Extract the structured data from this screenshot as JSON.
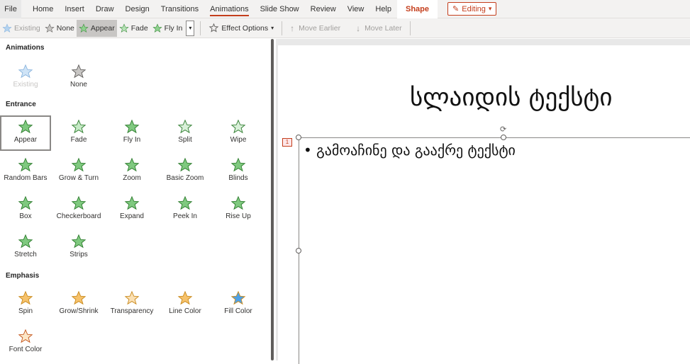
{
  "menu": {
    "tabs": [
      "File",
      "Home",
      "Insert",
      "Draw",
      "Design",
      "Transitions",
      "Animations",
      "Slide Show",
      "Review",
      "View",
      "Help",
      "Shape"
    ],
    "active": "Animations",
    "editing_label": "Editing"
  },
  "ribbon": {
    "existing": "Existing",
    "none": "None",
    "appear": "Appear",
    "fade": "Fade",
    "fly_in": "Fly In",
    "effect_options": "Effect Options",
    "move_earlier": "Move Earlier",
    "move_later": "Move Later"
  },
  "pane": {
    "sections": {
      "animations": "Animations",
      "entrance": "Entrance",
      "emphasis": "Emphasis"
    },
    "animations": [
      "Existing",
      "None"
    ],
    "entrance": [
      "Appear",
      "Fade",
      "Fly In",
      "Split",
      "Wipe",
      "Random Bars",
      "Grow & Turn",
      "Zoom",
      "Basic Zoom",
      "Blinds",
      "Box",
      "Checkerboard",
      "Expand",
      "Peek In",
      "Rise Up",
      "Stretch",
      "Strips"
    ],
    "emphasis": [
      "Spin",
      "Grow/Shrink",
      "Transparency",
      "Line Color",
      "Fill Color",
      "Font Color"
    ],
    "selected": "Appear"
  },
  "slide": {
    "title": "სლაიდის ტექსტი",
    "bullet": "• გამოაჩინე და გააქრე ტექსტი",
    "anim_tag": "1"
  },
  "colors": {
    "accent": "#c43e1c",
    "entrance_star": "#7fc97f",
    "emphasis_star": "#f6c26b"
  },
  "icons": {
    "star": "star-icon",
    "effect_options": "effect-options-icon",
    "up_arrow": "arrow-up-icon",
    "down_arrow": "arrow-down-icon",
    "pencil": "pencil-icon"
  }
}
